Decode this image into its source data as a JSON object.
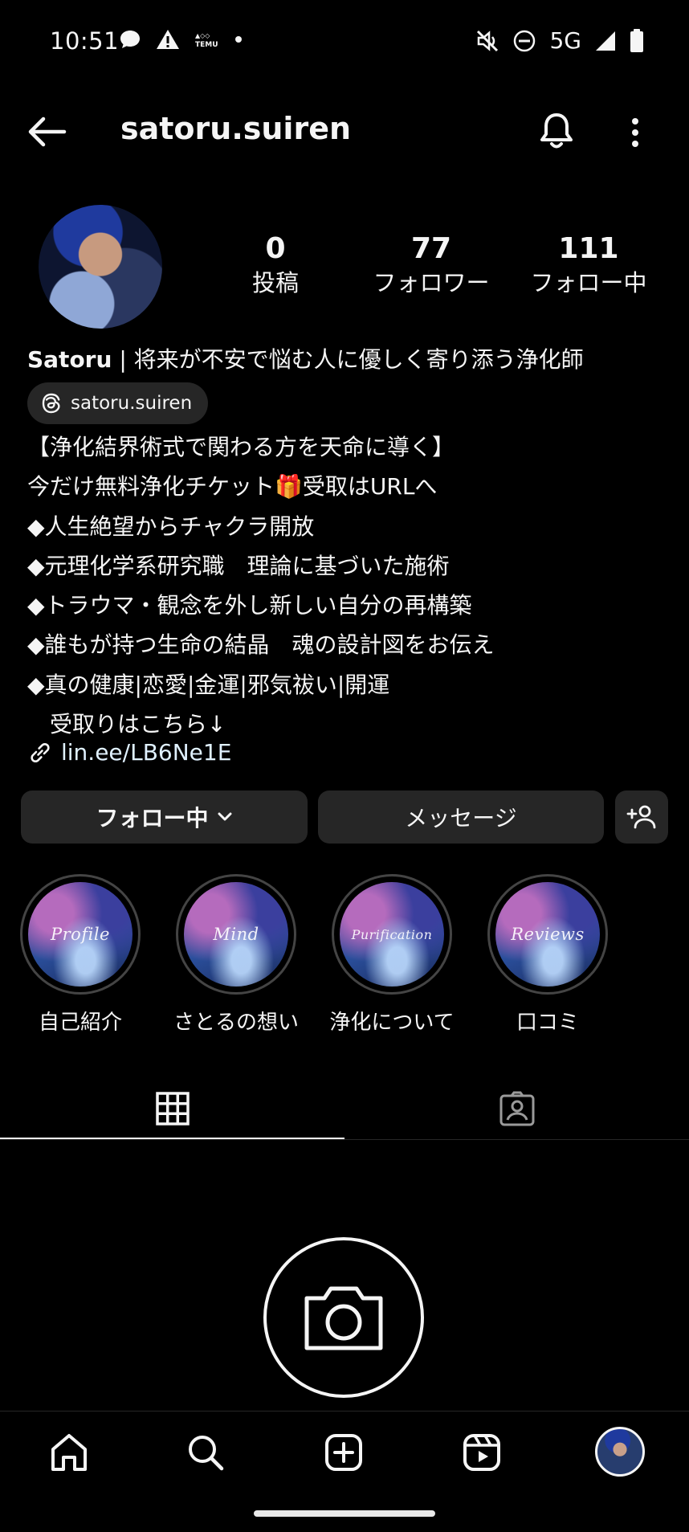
{
  "status_bar": {
    "time": "10:51",
    "network": "5G",
    "left_icons": [
      "chat-bubble-icon",
      "warning-icon",
      "temu-icon",
      "dot-icon"
    ],
    "right_icons": [
      "mute-icon",
      "do-not-disturb-icon",
      "signal-icon",
      "battery-icon"
    ]
  },
  "header": {
    "username": "satoru.suiren"
  },
  "profile": {
    "stats": [
      {
        "value": "0",
        "label": "投稿"
      },
      {
        "value": "77",
        "label": "フォロワー"
      },
      {
        "value": "111",
        "label": "フォロー中"
      }
    ],
    "bio_name": "Satoru",
    "bio_tagline": " | 将来が不安で悩む人に優しく寄り添う浄化師",
    "threads_handle": "satoru.suiren",
    "bio_lines": "【浄化結界術式で関わる方を天命に導く】\n今だけ無料浄化チケット🎁受取はURLへ\n◆人生絶望からチャクラ開放\n◆元理化学系研究職　理論に基づいた施術\n◆トラウマ・観念を外し新しい自分の再構築\n◆誰もが持つ生命の結晶　魂の設計図をお伝え\n◆真の健康|恋愛|金運|邪気祓い|開運\n　受取りはこちら↓",
    "link": "lin.ee/LB6Ne1E"
  },
  "actions": {
    "follow_label": "フォロー中",
    "message_label": "メッセージ"
  },
  "highlights": [
    {
      "cover_text": "Profile",
      "label": "自己紹介"
    },
    {
      "cover_text": "Mind",
      "label": "さとるの想い"
    },
    {
      "cover_text": "Purification",
      "label": "浄化について"
    },
    {
      "cover_text": "Reviews",
      "label": "口コミ"
    }
  ],
  "tabs": {
    "active": "grid",
    "items": [
      "grid-icon",
      "tagged-icon"
    ]
  },
  "theme": {
    "background": "#000000",
    "button_bg": "#262626",
    "text": "#f5f5f5"
  }
}
